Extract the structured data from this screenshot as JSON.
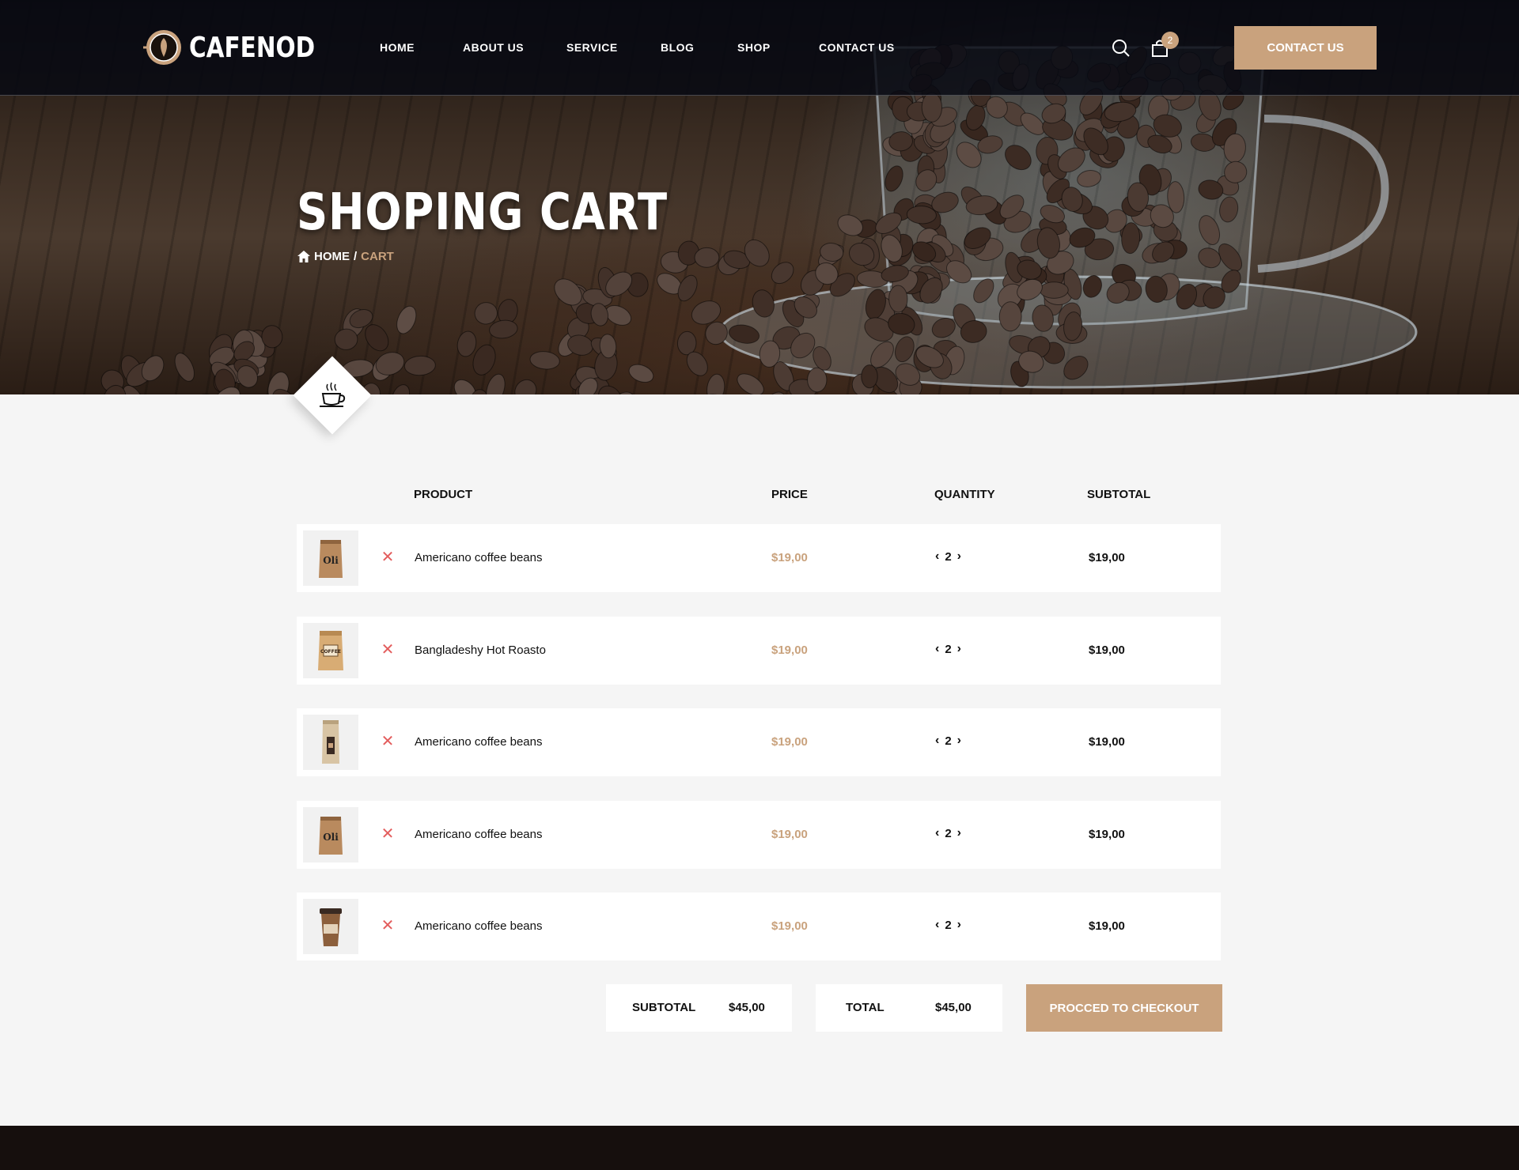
{
  "brand": {
    "name": "CAFENOD",
    "accent": "#c9a27d",
    "remove_color": "#e35d5d"
  },
  "nav": {
    "items": [
      "HOME",
      "ABOUT US",
      "SERVICE",
      "BLOG",
      "SHOP",
      "CONTACT US"
    ],
    "cart_count": "2",
    "contact_button": "CONTACT US"
  },
  "hero": {
    "title": "SHOPING CART",
    "breadcrumb": {
      "home": "HOME",
      "separator": "/",
      "current": "CART"
    }
  },
  "table": {
    "headers": {
      "product": "PRODUCT",
      "price": "PRICE",
      "quantity": "QUANTITY",
      "subtotal": "SUBTOTAL"
    },
    "rows": [
      {
        "name": "Americano coffee beans",
        "price": "$19,00",
        "qty": "2",
        "subtotal": "$19,00",
        "image": "bag-kraft-oli-icon"
      },
      {
        "name": "Bangladeshy Hot Roasto",
        "price": "$19,00",
        "qty": "2",
        "subtotal": "$19,00",
        "image": "bag-paper-label-icon"
      },
      {
        "name": "Americano coffee beans",
        "price": "$19,00",
        "qty": "2",
        "subtotal": "$19,00",
        "image": "bag-tall-dark-label-icon"
      },
      {
        "name": "Americano coffee beans",
        "price": "$19,00",
        "qty": "2",
        "subtotal": "$19,00",
        "image": "bag-kraft-oli-icon"
      },
      {
        "name": "Americano coffee beans",
        "price": "$19,00",
        "qty": "2",
        "subtotal": "$19,00",
        "image": "coffee-cup-icon"
      }
    ]
  },
  "totals": {
    "subtotal_label": "SUBTOTAL",
    "subtotal_value": "$45,00",
    "total_label": "TOTAL",
    "total_value": "$45,00",
    "checkout_button": "PROCCED TO CHECKOUT"
  }
}
